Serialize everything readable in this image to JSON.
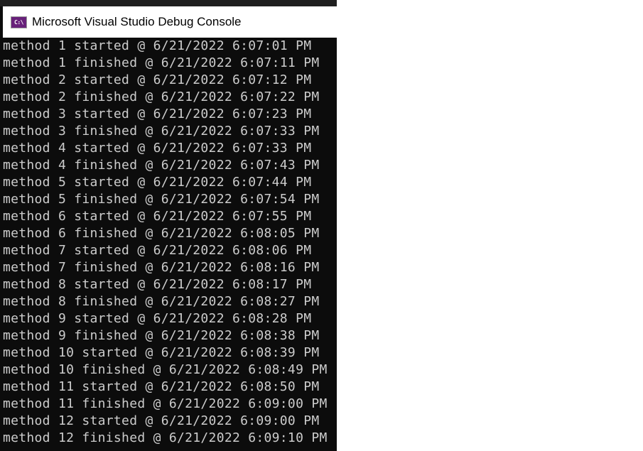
{
  "window": {
    "title": "Microsoft Visual Studio Debug Console",
    "icon_label": "C:\\"
  },
  "console": {
    "lines": [
      "method 1 started @ 6/21/2022 6:07:01 PM",
      "method 1 finished @ 6/21/2022 6:07:11 PM",
      "method 2 started @ 6/21/2022 6:07:12 PM",
      "method 2 finished @ 6/21/2022 6:07:22 PM",
      "method 3 started @ 6/21/2022 6:07:23 PM",
      "method 3 finished @ 6/21/2022 6:07:33 PM",
      "method 4 started @ 6/21/2022 6:07:33 PM",
      "method 4 finished @ 6/21/2022 6:07:43 PM",
      "method 5 started @ 6/21/2022 6:07:44 PM",
      "method 5 finished @ 6/21/2022 6:07:54 PM",
      "method 6 started @ 6/21/2022 6:07:55 PM",
      "method 6 finished @ 6/21/2022 6:08:05 PM",
      "method 7 started @ 6/21/2022 6:08:06 PM",
      "method 7 finished @ 6/21/2022 6:08:16 PM",
      "method 8 started @ 6/21/2022 6:08:17 PM",
      "method 8 finished @ 6/21/2022 6:08:27 PM",
      "method 9 started @ 6/21/2022 6:08:28 PM",
      "method 9 finished @ 6/21/2022 6:08:38 PM",
      "method 10 started @ 6/21/2022 6:08:39 PM",
      "method 10 finished @ 6/21/2022 6:08:49 PM",
      "method 11 started @ 6/21/2022 6:08:50 PM",
      "method 11 finished @ 6/21/2022 6:09:00 PM",
      "method 12 started @ 6/21/2022 6:09:00 PM",
      "method 12 finished @ 6/21/2022 6:09:10 PM"
    ]
  },
  "colors": {
    "console_bg": "#0c0c0c",
    "console_text": "#cccccc",
    "titlebar_bg": "#ffffff",
    "icon_bg": "#68217a"
  }
}
